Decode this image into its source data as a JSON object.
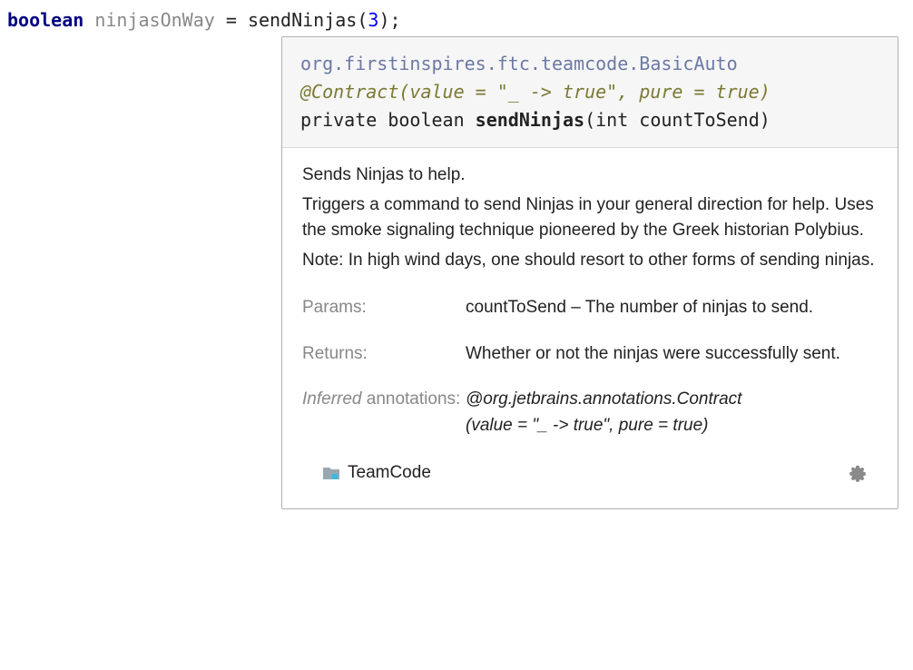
{
  "code": {
    "keyword": "boolean",
    "variable": " ninjasOnWay ",
    "equals": "= ",
    "method": "sendNinjas",
    "paren_open": "(",
    "arg": "3",
    "paren_close_semi": ");"
  },
  "tooltip": {
    "header": {
      "package": "org.firstinspires.ftc.teamcode.BasicAuto",
      "annotation": "@Contract(value = \"_ -> true\", pure = true)",
      "sig_prefix": "private boolean ",
      "method_name": "sendNinjas",
      "sig_suffix": "(int countToSend)"
    },
    "description": {
      "p1": "Sends Ninjas to help.",
      "p2": "Triggers a command to send Ninjas in your general direction for help. Uses the smoke signaling technique pioneered by the Greek historian Polybius.",
      "p3": "Note: In high wind days, one should resort to other forms of sending ninjas."
    },
    "sections": {
      "params_label": "Params:",
      "params_value": "countToSend – The number of ninjas to send.",
      "returns_label": "Returns:",
      "returns_value": "Whether or not the ninjas were successfully sent.",
      "inferred_label_1": "Inferred",
      "inferred_label_2": "annotations:",
      "inferred_value_1": "@org.jetbrains.annotations.Contract",
      "inferred_value_2": "(value = \"_ -> true\", pure = true)"
    },
    "footer": {
      "module": "TeamCode"
    }
  }
}
